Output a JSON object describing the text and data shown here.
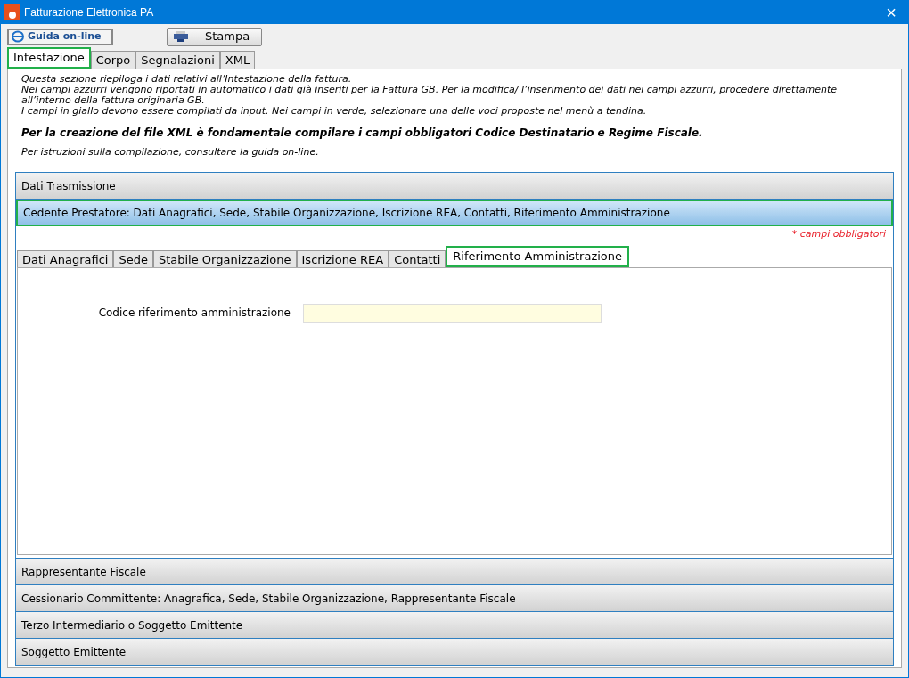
{
  "window": {
    "title": "Fatturazione Elettronica PA",
    "close": "×"
  },
  "toolbar": [
    {
      "kind": "help",
      "label": "Guida on-line"
    },
    {
      "kind": "print",
      "label": "Stampa"
    }
  ],
  "tabs": [
    {
      "label": "Intestazione",
      "selected": true
    },
    {
      "label": "Corpo",
      "selected": false
    },
    {
      "label": "Segnalazioni",
      "selected": false
    },
    {
      "label": "XML",
      "selected": false
    }
  ],
  "intro": [
    {
      "kind": "plain",
      "text": "Questa sezione riepiloga i dati relativi all’Intestazione della fattura.\nNei campi azzurri vengono riportati in automatico i dati già inseriti per la Fattura GB. Per la modifica/ l’inserimento dei dati nei campi azzurri, procedere direttamente all’interno della fattura originaria GB.\nI campi in giallo devono essere compilati da input. Nei campi in verde, selezionare una delle voci proposte nel menù a tendina."
    },
    {
      "kind": "bold",
      "text": "Per la creazione del file XML è fondamentale compilare i campi obbligatori Codice Destinatario e Regime Fiscale."
    },
    {
      "kind": "plain",
      "text": "Per istruzioni sulla compilazione, consultare la guida on-line."
    }
  ],
  "sections": [
    {
      "title": "Dati Trasmissione",
      "expanded": false
    },
    {
      "title": "Cedente Prestatore: Dati Anagrafici, Sede, Stabile Organizzazione, Iscrizione REA, Contatti, Riferimento Amministrazione",
      "expanded": true,
      "required_note": "* campi obbligatori",
      "subtabs": [
        {
          "label": "Dati Anagrafici",
          "selected": false
        },
        {
          "label": "Sede",
          "selected": false
        },
        {
          "label": "Stabile Organizzazione",
          "selected": false
        },
        {
          "label": "Iscrizione REA",
          "selected": false
        },
        {
          "label": "Contatti",
          "selected": false
        },
        {
          "label": "Riferimento Amministrazione",
          "selected": true
        }
      ],
      "fields": [
        {
          "label": "Codice riferimento amministrazione"
        }
      ]
    },
    {
      "title": "Rappresentante Fiscale",
      "expanded": false
    },
    {
      "title": "Cessionario Committente: Anagrafica, Sede, Stabile Organizzazione, Rappresentante Fiscale",
      "expanded": false
    },
    {
      "title": "Terzo Intermediario o Soggetto Emittente",
      "expanded": false
    },
    {
      "title": "Soggetto Emittente",
      "expanded": false
    }
  ]
}
